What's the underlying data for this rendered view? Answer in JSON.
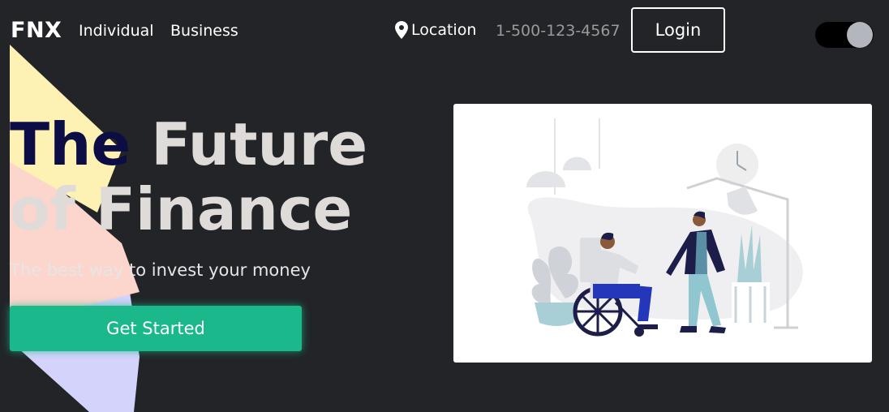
{
  "brand": {
    "logo_text": "FNX"
  },
  "nav": {
    "links": [
      {
        "label": "Individual"
      },
      {
        "label": "Business"
      }
    ],
    "location_label": "Location",
    "phone": "1-500-123-4567",
    "login_label": "Login",
    "theme_toggle": {
      "state": "on"
    }
  },
  "hero": {
    "title_accent": "The",
    "title_rest": " Future of Finance",
    "subtitle": "The best way to invest your money",
    "cta_label": "Get Started"
  },
  "colors": {
    "background": "#222428",
    "cta": "#1bb88c",
    "title_accent": "#0d0d45",
    "title_text": "#dedbd8",
    "shape_yellow": "#fdf1b3",
    "shape_peach": "#fcd5cc",
    "shape_lavender": "#d4d3fb"
  },
  "illustration": {
    "subject": "person-in-wheelchair-meeting-person-illustration"
  }
}
